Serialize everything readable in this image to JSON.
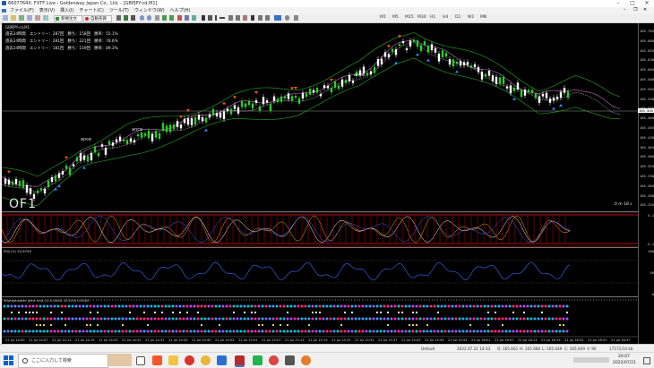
{
  "window": {
    "title": "6607764X: FXTF Live - Goldenway Japan Co., Ltd. - [GBPJPY-cd,M1]",
    "controls": [
      "minimize-icon",
      "maximize-icon",
      "close-icon"
    ]
  },
  "menu": [
    "ファイル(F)",
    "表示(V)",
    "挿入(I)",
    "チャート(C)",
    "ツール(T)",
    "ウィンドウ(W)",
    "ヘルプ(H)"
  ],
  "toolbar": {
    "new_order": "新規注文",
    "auto_trade": "自動売買",
    "timeframes": [
      "M1",
      "M5",
      "M15",
      "M30",
      "H1",
      "H4",
      "D1",
      "W1",
      "MN"
    ]
  },
  "chart": {
    "symbol_label": "GBPJPY-cd,M1",
    "stats": [
      "過去24時間　エントリー：287回　勝ち：158回　勝率：55.1%",
      "過去24時間　エントリー：281回　勝ち：221回　勝率：78.6%",
      "過去24時間　エントリー：181回　勝ち：159回　勝率：89.3%"
    ],
    "watermark": "OF1",
    "countdown": "0 m 18 s",
    "annotations": [
      "ance",
      "ance",
      "ance"
    ],
    "price_labels": [
      "165.705",
      "165.680",
      "165.655",
      "165.630",
      "165.605",
      "165.580",
      "165.555",
      "165.530",
      "165.505",
      "165.480",
      "165.455",
      "165.430",
      "165.405",
      "165.380",
      "165.355",
      "165.330",
      "165.305",
      "165.280",
      "165.255"
    ],
    "current_price": "165.505",
    "rsi_label": "RSI(14) 30.8799",
    "rsi_scale": [
      "100",
      "50",
      "0"
    ],
    "osc_scale": [
      "5.1",
      "0",
      "-5.1"
    ],
    "indicator_label": "Sharpshooter Alert Ima (1) 0.0000 -0.0133 0.0000",
    "times": [
      "21 Jul 14:00",
      "21 Jul 14:07",
      "21 Jul 14:13",
      "21 Jul 14:19",
      "21 Jul 14:25",
      "21 Jul 14:31",
      "21 Jul 14:37",
      "21 Jul 14:43",
      "21 Jul 14:49",
      "21 Jul 14:55",
      "21 Jul 15:01",
      "21 Jul 15:07",
      "21 Jul 15:13",
      "21 Jul 15:19",
      "21 Jul 15:25",
      "21 Jul 15:31",
      "21 Jul 15:37",
      "21 Jul 15:43",
      "21 Jul 15:49",
      "21 Jul 15:55",
      "21 Jul 16:01",
      "21 Jul 16:07",
      "21 Jul 16:13",
      "21 Jul 16:19",
      "21 Jul 16:25",
      "21 Jul 16:31",
      "21 Jul 16:37"
    ],
    "colors": {
      "bull": "#2ecc2e",
      "bear": "#ffffff",
      "arrow_sell": "#ff5a1e",
      "arrow_buy": "#2f8cff",
      "band": "#22aa22",
      "ma1": "#cc66cc",
      "ma2": "#ffffff"
    }
  },
  "status": {
    "profile": "Default",
    "datetime": "2022.07.21 14:33",
    "open": "O: 165.661",
    "high": "H: 165.680",
    "low": "L: 165.649",
    "close": "C: 165.649",
    "volume": "V: 96",
    "connection": "17171/14 kb"
  },
  "taskbar": {
    "search_placeholder": "ここに入力して検索",
    "clock_time": "20:07",
    "clock_date": "2022/07/21"
  }
}
